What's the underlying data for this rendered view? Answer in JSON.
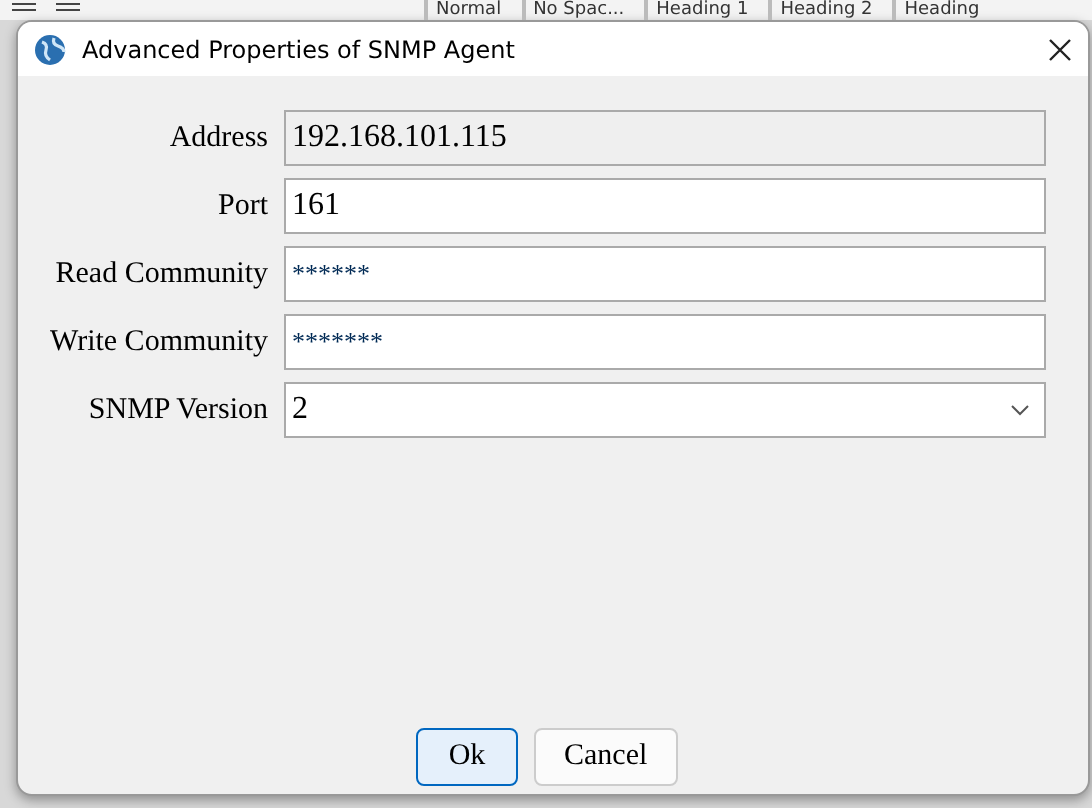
{
  "background_app": {
    "styles": [
      "Normal",
      "No Spac...",
      "Heading 1",
      "Heading 2",
      "Heading"
    ]
  },
  "window": {
    "title": "Advanced Properties of SNMP Agent"
  },
  "fields": [
    {
      "label": "Address",
      "value": "192.168.101.115",
      "kind": "text",
      "disabled": true
    },
    {
      "label": "Port",
      "value": "161",
      "kind": "text",
      "disabled": false
    },
    {
      "label": "Read Community",
      "value": "******",
      "kind": "password",
      "disabled": false
    },
    {
      "label": "Write Community",
      "value": "*******",
      "kind": "password",
      "disabled": false
    },
    {
      "label": "SNMP Version",
      "value": "2",
      "kind": "dropdown",
      "disabled": false
    }
  ],
  "buttons": [
    {
      "label": "Ok",
      "default": true
    },
    {
      "label": "Cancel",
      "default": false
    }
  ]
}
